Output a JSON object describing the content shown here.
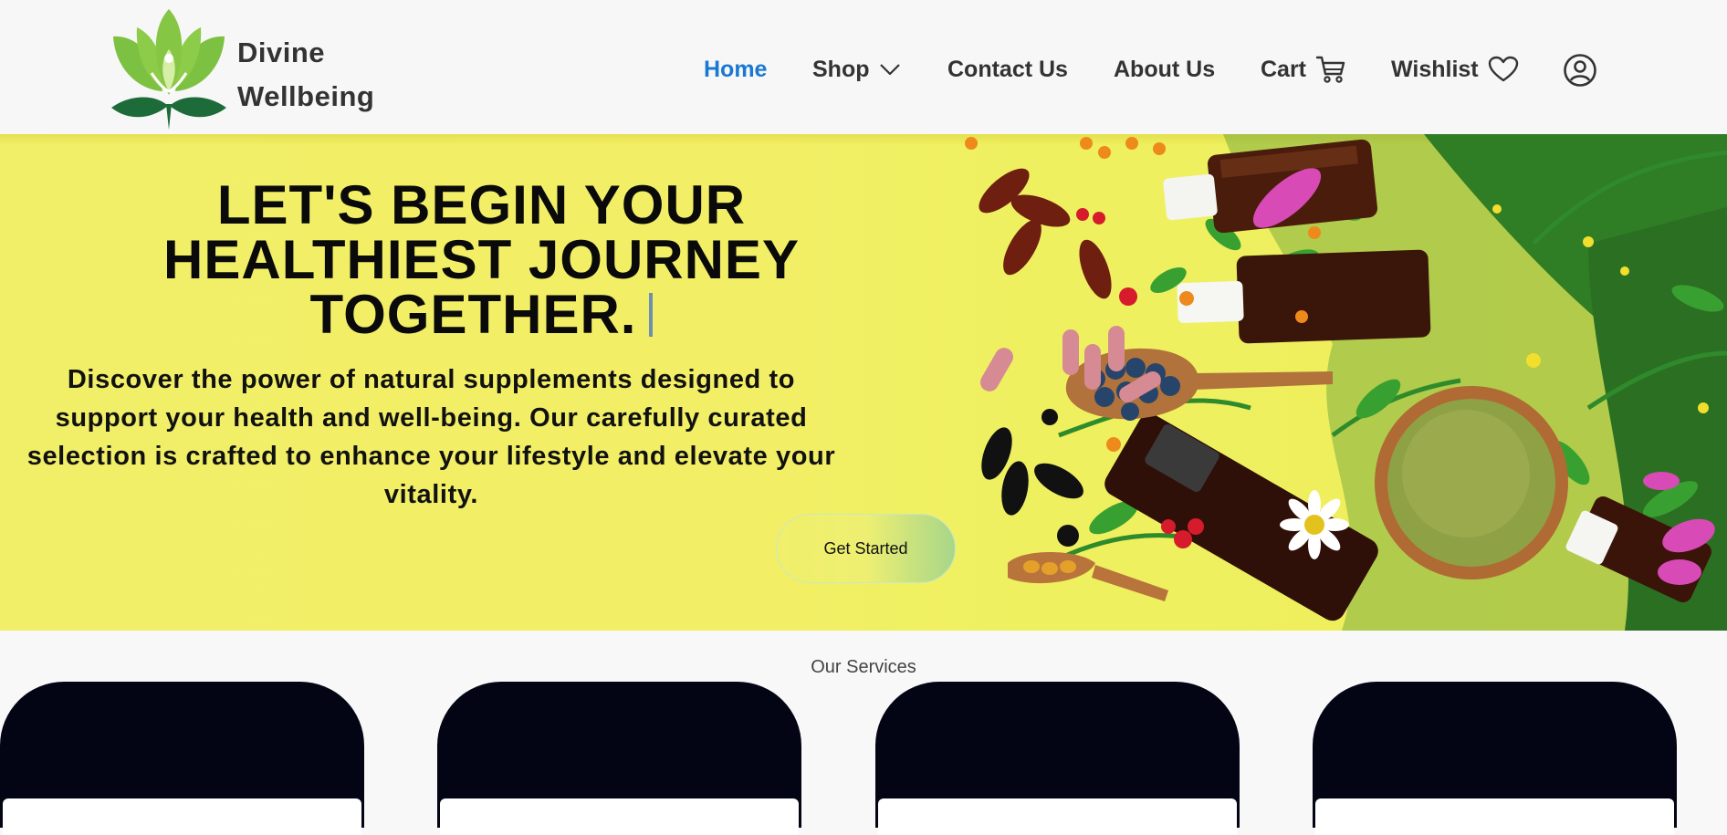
{
  "brand": {
    "name_line1": "Divine",
    "name_line2": "Wellbeing"
  },
  "nav": {
    "items": [
      {
        "label": "Home",
        "active": true
      },
      {
        "label": "Shop",
        "icon": "chevron-down-icon"
      },
      {
        "label": "Contact Us"
      },
      {
        "label": "About Us"
      },
      {
        "label": "Cart",
        "icon": "cart-icon"
      },
      {
        "label": "Wishlist",
        "icon": "heart-icon"
      }
    ],
    "profile_icon": "user-circle-icon",
    "active_color": "#1a78d2"
  },
  "hero": {
    "title_lines": [
      "LET'S BEGIN YOUR",
      "HEALTHIEST JOURNEY",
      "TOGETHER."
    ],
    "text_lines": [
      "Discover the power of natural supplements designed to",
      "support your health and well-being. Our carefully curated",
      "selection is crafted to enhance your lifestyle and elevate your",
      "vitality."
    ],
    "cta_label": "Get Started",
    "background_color": "#f1ef68"
  },
  "services": {
    "title": "Our Services",
    "card_color": "#030515"
  }
}
